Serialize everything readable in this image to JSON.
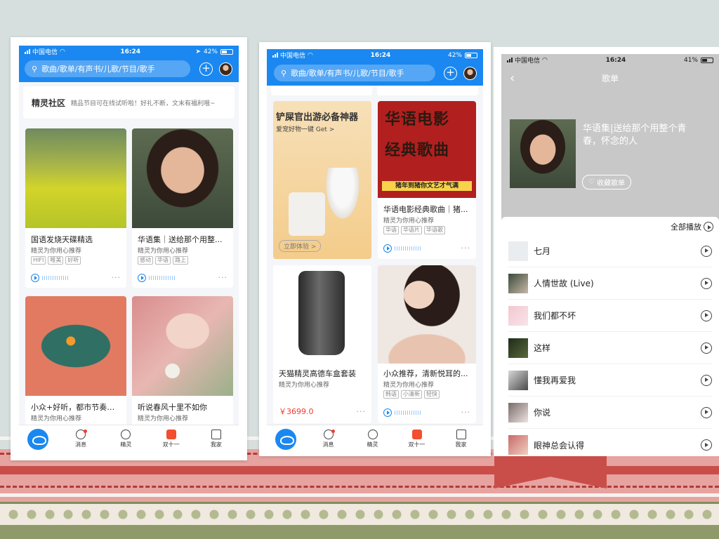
{
  "phone1": {
    "status": {
      "carrier": "中国电信",
      "time": "16:24",
      "battery": "42%"
    },
    "search_placeholder": "歌曲/歌单/有声书/儿歌/节目/歌手",
    "community": {
      "title": "精灵社区",
      "desc": "精品节目可在线试听啦！好礼不断，文末有福利哦~"
    },
    "cards": [
      {
        "title": "国语发烧天碟精选",
        "sub": "精灵为你用心推荐",
        "tags": [
          "HIFI",
          "唯美",
          "好听"
        ]
      },
      {
        "title": "华语集｜送给那个用整...",
        "sub": "精灵为你用心推荐",
        "tags": [
          "感动",
          "华语",
          "路上"
        ]
      },
      {
        "title": "小众+好听，都市节奏蓝...",
        "sub": "精灵为你用心推荐",
        "tags": []
      },
      {
        "title": "听说春风十里不如你",
        "sub": "精灵为你用心推荐",
        "tags": []
      }
    ],
    "tabs": [
      "消息",
      "精灵",
      "双十一",
      "我家"
    ]
  },
  "phone2": {
    "status": {
      "carrier": "中国电信",
      "time": "16:24",
      "battery": "42%"
    },
    "search_placeholder": "歌曲/歌单/有声书/儿歌/节目/歌手",
    "ad": {
      "title": "铲屎官出游必备神器",
      "sub": "爱宠好物一键 Get >",
      "button": "立即体验 >"
    },
    "cards": [
      {
        "poster_line1": "华语电影",
        "poster_line2": "经典歌曲",
        "banner": "猪年到猪你文艺才气满",
        "title": "华语电影经典歌曲｜猪...",
        "sub": "精灵为你用心推荐",
        "tags": [
          "华语",
          "华语片",
          "华语歌"
        ]
      },
      {
        "title": "天猫精灵高德车盒套装",
        "sub": "精灵为你用心推荐",
        "price": "￥3699.0"
      },
      {
        "title": "小众推荐，清新悦耳的...",
        "sub": "精灵为你用心推荐",
        "tags": [
          "韩语",
          "小清新",
          "轻快"
        ]
      }
    ],
    "tabs": [
      "消息",
      "精灵",
      "双十一",
      "我家"
    ]
  },
  "phone3": {
    "status": {
      "carrier": "中国电信",
      "time": "16:24",
      "battery": "41%"
    },
    "nav_title": "歌单",
    "playlist_title": "华语集|送给那个用整个青春，怀念的人",
    "favorite_label": "收藏歌单",
    "play_all": "全部播放",
    "songs": [
      "七月",
      "人情世故 (Live)",
      "我们都不坏",
      "这样",
      "懂我再爱我",
      "你说",
      "眼神总会认得"
    ]
  },
  "colors": {
    "accent": "#1a88f0",
    "price": "#f23a2f"
  }
}
